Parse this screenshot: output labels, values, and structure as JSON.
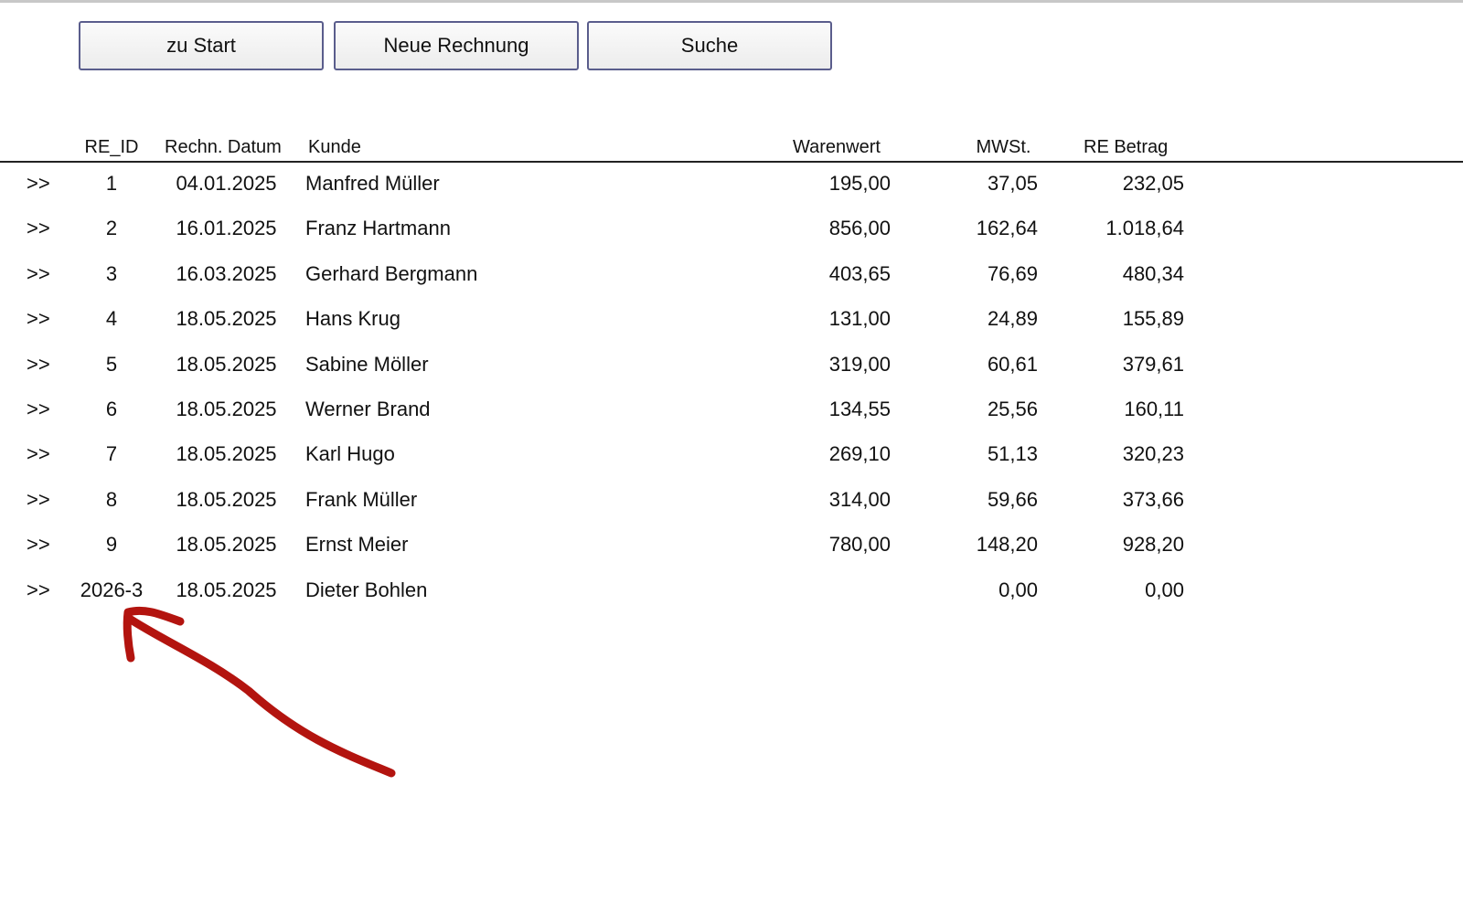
{
  "toolbar": {
    "start_label": "zu Start",
    "new_invoice_label": "Neue Rechnung",
    "search_label": "Suche"
  },
  "table": {
    "headers": {
      "id": "RE_ID",
      "date": "Rechn. Datum",
      "customer": "Kunde",
      "goods_value": "Warenwert",
      "vat": "MWSt.",
      "total": "RE Betrag"
    },
    "row_link_label": ">>",
    "rows": [
      {
        "id": "1",
        "date": "04.01.2025",
        "customer": "Manfred Müller",
        "goods_value": "195,00",
        "vat": "37,05",
        "total": "232,05"
      },
      {
        "id": "2",
        "date": "16.01.2025",
        "customer": "Franz Hartmann",
        "goods_value": "856,00",
        "vat": "162,64",
        "total": "1.018,64"
      },
      {
        "id": "3",
        "date": "16.03.2025",
        "customer": "Gerhard Bergmann",
        "goods_value": "403,65",
        "vat": "76,69",
        "total": "480,34"
      },
      {
        "id": "4",
        "date": "18.05.2025",
        "customer": "Hans Krug",
        "goods_value": "131,00",
        "vat": "24,89",
        "total": "155,89"
      },
      {
        "id": "5",
        "date": "18.05.2025",
        "customer": "Sabine Möller",
        "goods_value": "319,00",
        "vat": "60,61",
        "total": "379,61"
      },
      {
        "id": "6",
        "date": "18.05.2025",
        "customer": "Werner Brand",
        "goods_value": "134,55",
        "vat": "25,56",
        "total": "160,11"
      },
      {
        "id": "7",
        "date": "18.05.2025",
        "customer": "Karl Hugo",
        "goods_value": "269,10",
        "vat": "51,13",
        "total": "320,23"
      },
      {
        "id": "8",
        "date": "18.05.2025",
        "customer": "Frank Müller",
        "goods_value": "314,00",
        "vat": "59,66",
        "total": "373,66"
      },
      {
        "id": "9",
        "date": "18.05.2025",
        "customer": "Ernst Meier",
        "goods_value": "780,00",
        "vat": "148,20",
        "total": "928,20"
      },
      {
        "id": "2026-3",
        "date": "18.05.2025",
        "customer": "Dieter Bohlen",
        "goods_value": "",
        "vat": "0,00",
        "total": "0,00"
      }
    ]
  },
  "colors": {
    "button_border": "#5a5d8c",
    "annotation_arrow": "#b3140f",
    "header_line": "#222222"
  }
}
